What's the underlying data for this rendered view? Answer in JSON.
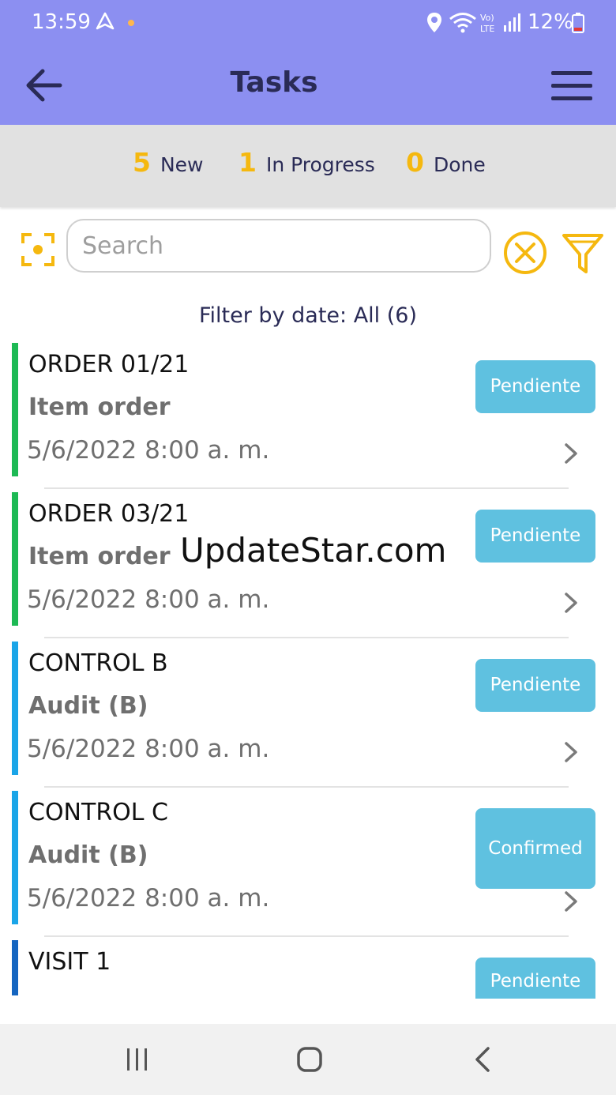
{
  "status_bar": {
    "time": "13:59",
    "battery": "12%",
    "icons": [
      "navigation-icon",
      "location-icon",
      "wifi-icon",
      "volte-icon",
      "signal-icon",
      "battery-icon"
    ]
  },
  "app_bar": {
    "title": "Tasks",
    "back_icon": "arrow-back-icon",
    "menu_icon": "hamburger-menu-icon"
  },
  "counts": [
    {
      "value": "5",
      "label": "New"
    },
    {
      "value": "1",
      "label": "In Progress"
    },
    {
      "value": "0",
      "label": "Done"
    }
  ],
  "search": {
    "placeholder": "Search",
    "value": ""
  },
  "filter_by_date": "Filter by date: All (6)",
  "tasks": [
    {
      "title": "ORDER 01/21",
      "subtitle": "Item order",
      "date": "5/6/2022 8:00 a. m.",
      "status": "Pendiente",
      "accent": "#1db954"
    },
    {
      "title": "ORDER 03/21",
      "subtitle": "Item order",
      "date": "5/6/2022 8:00 a. m.",
      "status": "Pendiente",
      "accent": "#1db954"
    },
    {
      "title": "CONTROL B",
      "subtitle": "Audit (B)",
      "date": "5/6/2022 8:00 a. m.",
      "status": "Pendiente",
      "accent": "#1aa5e8"
    },
    {
      "title": "CONTROL C",
      "subtitle": "Audit (B)",
      "date": "5/6/2022 8:00 a. m.",
      "status": "Confirmed",
      "accent": "#1aa5e8"
    },
    {
      "title": "VISIT 1",
      "subtitle": "",
      "date": "",
      "status": "Pendiente",
      "accent": "#1565c0"
    }
  ],
  "watermark": "UpdateStar.com",
  "colors": {
    "header": "#8c8ff1",
    "count_number": "#f5b80f",
    "status_button": "#5fc1e0",
    "icon_accent": "#f5b80f"
  }
}
